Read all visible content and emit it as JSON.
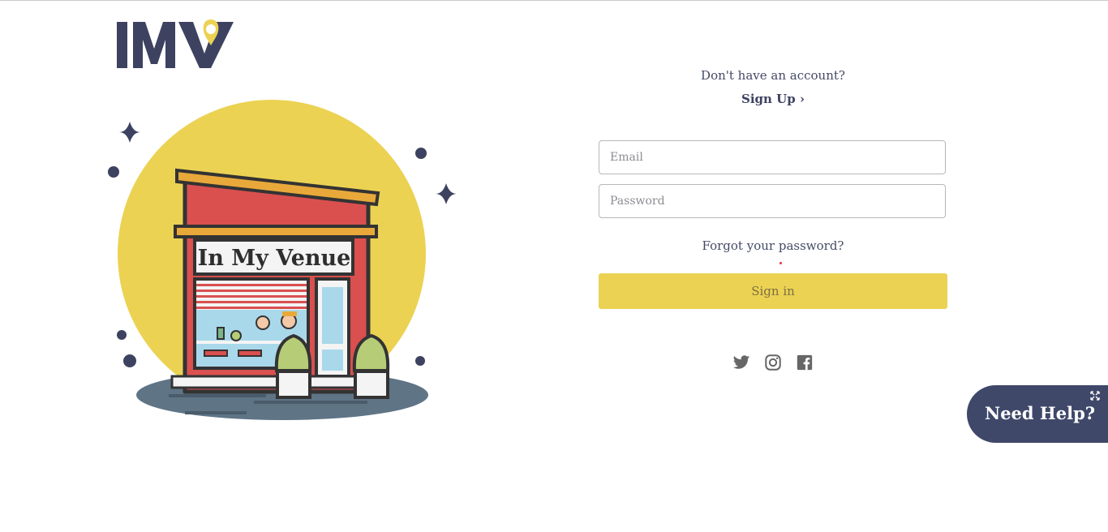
{
  "brand": {
    "logo_text": "IMV",
    "illustration_sign": "In My Venue"
  },
  "auth": {
    "no_account": "Don't have an account?",
    "signup_label": "Sign Up ›",
    "email_placeholder": "Email",
    "password_placeholder": "Password",
    "forgot_label": "Forgot your password?",
    "signin_label": "Sign in"
  },
  "social": [
    "twitter-icon",
    "instagram-icon",
    "facebook-icon"
  ],
  "help_widget": {
    "label": "Need Help?"
  },
  "colors": {
    "brand_navy": "#3d4260",
    "accent_yellow": "#ecd253",
    "red": "#d9504f"
  }
}
